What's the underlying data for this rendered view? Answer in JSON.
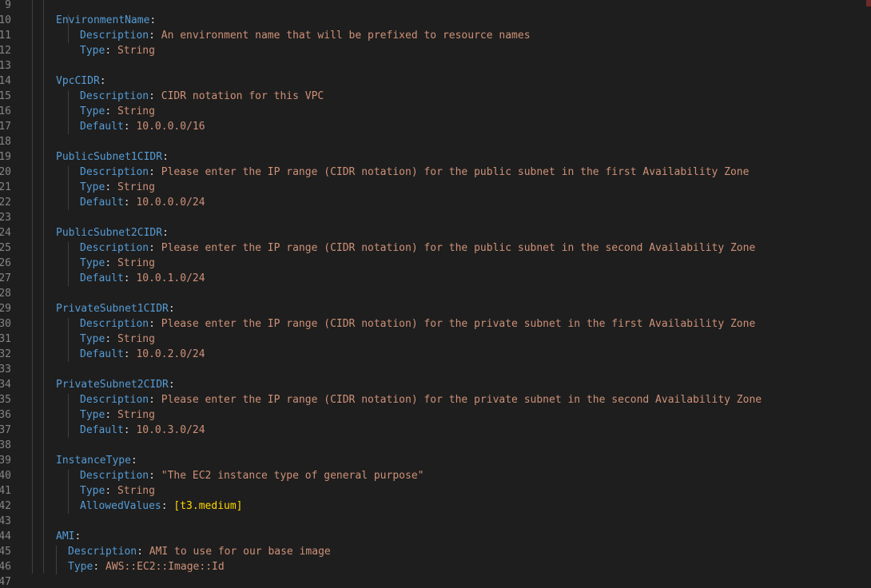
{
  "lines": [
    {
      "n": "9",
      "indent": 0,
      "key": "",
      "value": ""
    },
    {
      "n": "10",
      "indent": 1,
      "key": "EnvironmentName",
      "value": ""
    },
    {
      "n": "11",
      "indent": 2,
      "key": "Description",
      "value": "An environment name that will be prefixed to resource names"
    },
    {
      "n": "12",
      "indent": 2,
      "key": "Type",
      "value": "String"
    },
    {
      "n": "13",
      "indent": 0,
      "key": "",
      "value": ""
    },
    {
      "n": "14",
      "indent": 1,
      "key": "VpcCIDR",
      "value": ""
    },
    {
      "n": "15",
      "indent": 2,
      "key": "Description",
      "value": "CIDR notation for this VPC"
    },
    {
      "n": "16",
      "indent": 2,
      "key": "Type",
      "value": "String"
    },
    {
      "n": "17",
      "indent": 2,
      "key": "Default",
      "value": "10.0.0.0/16"
    },
    {
      "n": "18",
      "indent": 0,
      "key": "",
      "value": ""
    },
    {
      "n": "19",
      "indent": 1,
      "key": "PublicSubnet1CIDR",
      "value": ""
    },
    {
      "n": "20",
      "indent": 2,
      "key": "Description",
      "value": "Please enter the IP range (CIDR notation) for the public subnet in the first Availability Zone"
    },
    {
      "n": "21",
      "indent": 2,
      "key": "Type",
      "value": "String"
    },
    {
      "n": "22",
      "indent": 2,
      "key": "Default",
      "value": "10.0.0.0/24"
    },
    {
      "n": "23",
      "indent": 0,
      "key": "",
      "value": ""
    },
    {
      "n": "24",
      "indent": 1,
      "key": "PublicSubnet2CIDR",
      "value": ""
    },
    {
      "n": "25",
      "indent": 2,
      "key": "Description",
      "value": "Please enter the IP range (CIDR notation) for the public subnet in the second Availability Zone"
    },
    {
      "n": "26",
      "indent": 2,
      "key": "Type",
      "value": "String"
    },
    {
      "n": "27",
      "indent": 2,
      "key": "Default",
      "value": "10.0.1.0/24"
    },
    {
      "n": "28",
      "indent": 0,
      "key": "",
      "value": ""
    },
    {
      "n": "29",
      "indent": 1,
      "key": "PrivateSubnet1CIDR",
      "value": ""
    },
    {
      "n": "30",
      "indent": 2,
      "key": "Description",
      "value": "Please enter the IP range (CIDR notation) for the private subnet in the first Availability Zone"
    },
    {
      "n": "31",
      "indent": 2,
      "key": "Type",
      "value": "String"
    },
    {
      "n": "32",
      "indent": 2,
      "key": "Default",
      "value": "10.0.2.0/24"
    },
    {
      "n": "33",
      "indent": 0,
      "key": "",
      "value": ""
    },
    {
      "n": "34",
      "indent": 1,
      "key": "PrivateSubnet2CIDR",
      "value": ""
    },
    {
      "n": "35",
      "indent": 2,
      "key": "Description",
      "value": "Please enter the IP range (CIDR notation) for the private subnet in the second Availability Zone"
    },
    {
      "n": "36",
      "indent": 2,
      "key": "Type",
      "value": "String"
    },
    {
      "n": "37",
      "indent": 2,
      "key": "Default",
      "value": "10.0.3.0/24"
    },
    {
      "n": "38",
      "indent": 0,
      "key": "",
      "value": ""
    },
    {
      "n": "39",
      "indent": 1,
      "key": "InstanceType",
      "value": ""
    },
    {
      "n": "40",
      "indent": 2,
      "key": "Description",
      "value": "\"The EC2 instance type of general purpose\""
    },
    {
      "n": "41",
      "indent": 2,
      "key": "Type",
      "value": "String"
    },
    {
      "n": "42",
      "indent": 2,
      "key": "AllowedValues",
      "value": "[t3.medium]",
      "flow": true
    },
    {
      "n": "43",
      "indent": 0,
      "key": "",
      "value": ""
    },
    {
      "n": "44",
      "indent": 1,
      "key": "AMI",
      "value": ""
    },
    {
      "n": "45",
      "indent": 3,
      "key": "Description",
      "value": "AMI to use for our base image"
    },
    {
      "n": "46",
      "indent": 3,
      "key": "Type",
      "value": "AWS::EC2::Image::Id"
    },
    {
      "n": "47",
      "indent": 0,
      "key": "",
      "value": ""
    }
  ],
  "colors": {
    "background": "#1e1e1e",
    "line_number": "#858585",
    "key": "#569cd6",
    "string": "#ce9178",
    "punctuation": "#d4d4d4",
    "bracket": "#ffd700"
  }
}
